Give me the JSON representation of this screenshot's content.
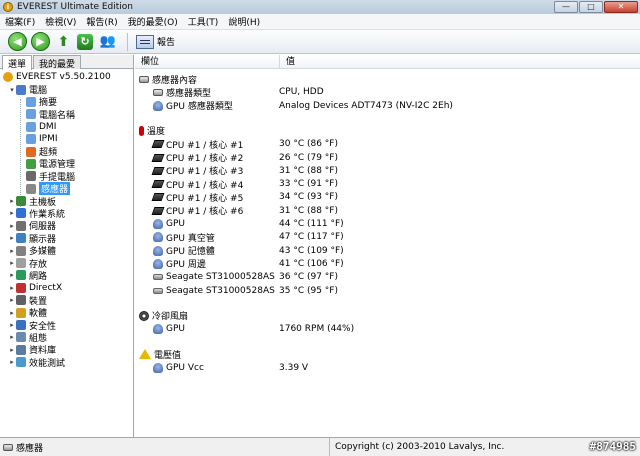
{
  "window": {
    "title": "EVEREST Ultimate Edition",
    "minimize": "—",
    "maximize": "□",
    "close": "✕"
  },
  "menu": [
    "檔案(F)",
    "檢視(V)",
    "報告(R)",
    "我的最愛(O)",
    "工具(T)",
    "說明(H)"
  ],
  "toolbar": {
    "report_label": "報告"
  },
  "left_tabs": [
    "選單",
    "我的最愛"
  ],
  "tree": [
    {
      "label": "EVEREST v5.50.2100",
      "level": 0,
      "icon": "info-icon",
      "color": "#e8a010"
    },
    {
      "label": "電腦",
      "level": 1,
      "icon": "computer-icon",
      "color": "#4a7ac8",
      "expander": "▾"
    },
    {
      "label": "摘要",
      "level": 2,
      "icon": "summary-icon",
      "color": "#6aa0e0"
    },
    {
      "label": "電腦名稱",
      "level": 2,
      "icon": "computer-name-icon",
      "color": "#6aa0e0"
    },
    {
      "label": "DMI",
      "level": 2,
      "icon": "dmi-icon",
      "color": "#6aa0e0"
    },
    {
      "label": "IPMI",
      "level": 2,
      "icon": "ipmi-icon",
      "color": "#6aa0e0"
    },
    {
      "label": "超頻",
      "level": 2,
      "icon": "overclock-icon",
      "color": "#e06a20"
    },
    {
      "label": "電源管理",
      "level": 2,
      "icon": "power-icon",
      "color": "#40a040"
    },
    {
      "label": "手提電腦",
      "level": 2,
      "icon": "laptop-icon",
      "color": "#6a6a6a"
    },
    {
      "label": "感應器",
      "level": 2,
      "icon": "sensor-icon",
      "color": "#888888",
      "selected": true
    },
    {
      "label": "主機板",
      "level": 1,
      "icon": "motherboard-icon",
      "color": "#3a8a3a",
      "expander": "▸"
    },
    {
      "label": "作業系統",
      "level": 1,
      "icon": "os-icon",
      "color": "#3070d0",
      "expander": "▸"
    },
    {
      "label": "伺服器",
      "level": 1,
      "icon": "server-icon",
      "color": "#707070",
      "expander": "▸"
    },
    {
      "label": "顯示器",
      "level": 1,
      "icon": "display-icon",
      "color": "#4080c0",
      "expander": "▸"
    },
    {
      "label": "多媒體",
      "level": 1,
      "icon": "multimedia-icon",
      "color": "#808080",
      "expander": "▸"
    },
    {
      "label": "存放",
      "level": 1,
      "icon": "storage-icon",
      "color": "#a0a0a0",
      "expander": "▸"
    },
    {
      "label": "網路",
      "level": 1,
      "icon": "network-icon",
      "color": "#2a9a5a",
      "expander": "▸"
    },
    {
      "label": "DirectX",
      "level": 1,
      "icon": "directx-icon",
      "color": "#c03030",
      "expander": "▸"
    },
    {
      "label": "裝置",
      "level": 1,
      "icon": "devices-icon",
      "color": "#606060",
      "expander": "▸"
    },
    {
      "label": "軟體",
      "level": 1,
      "icon": "software-icon",
      "color": "#d0a020",
      "expander": "▸"
    },
    {
      "label": "安全性",
      "level": 1,
      "icon": "security-icon",
      "color": "#3a70c0",
      "expander": "▸"
    },
    {
      "label": "組態",
      "level": 1,
      "icon": "config-icon",
      "color": "#6a8ab0",
      "expander": "▸"
    },
    {
      "label": "資料庫",
      "level": 1,
      "icon": "database-icon",
      "color": "#5a7aa0",
      "expander": "▸"
    },
    {
      "label": "效能測試",
      "level": 1,
      "icon": "benchmark-icon",
      "color": "#4a9ad0",
      "expander": "▸"
    }
  ],
  "columns": {
    "field": "欄位",
    "value": "值"
  },
  "sections": [
    {
      "title": "感應器內容",
      "icon": "sensor-icon",
      "rows": [
        {
          "name": "感應器類型",
          "value": "CPU, HDD",
          "icon": "sensor-icon"
        },
        {
          "name": "GPU 感應器類型",
          "value": "Analog Devices ADT7473  (NV-I2C 2Eh)",
          "icon": "gpu-icon"
        }
      ]
    },
    {
      "title": "溫度",
      "icon": "thermometer-icon",
      "rows": [
        {
          "name": "CPU #1 / 核心 #1",
          "value": "30 °C  (86 °F)",
          "icon": "cpu-icon"
        },
        {
          "name": "CPU #1 / 核心 #2",
          "value": "26 °C  (79 °F)",
          "icon": "cpu-icon"
        },
        {
          "name": "CPU #1 / 核心 #3",
          "value": "31 °C  (88 °F)",
          "icon": "cpu-icon"
        },
        {
          "name": "CPU #1 / 核心 #4",
          "value": "33 °C  (91 °F)",
          "icon": "cpu-icon"
        },
        {
          "name": "CPU #1 / 核心 #5",
          "value": "34 °C  (93 °F)",
          "icon": "cpu-icon"
        },
        {
          "name": "CPU #1 / 核心 #6",
          "value": "31 °C  (88 °F)",
          "icon": "cpu-icon"
        },
        {
          "name": "GPU",
          "value": "44 °C  (111 °F)",
          "icon": "gpu-icon"
        },
        {
          "name": "GPU 真空管",
          "value": "47 °C  (117 °F)",
          "icon": "gpu-icon"
        },
        {
          "name": "GPU 記憶體",
          "value": "43 °C  (109 °F)",
          "icon": "gpu-icon"
        },
        {
          "name": "GPU 周邊",
          "value": "41 °C  (106 °F)",
          "icon": "gpu-icon"
        },
        {
          "name": "Seagate ST31000528AS",
          "value": "36 °C  (97 °F)",
          "icon": "hdd-icon"
        },
        {
          "name": "Seagate ST31000528AS",
          "value": "35 °C  (95 °F)",
          "icon": "hdd-icon"
        }
      ]
    },
    {
      "title": "冷卻風扇",
      "icon": "fan-icon",
      "rows": [
        {
          "name": "GPU",
          "value": "1760 RPM  (44%)",
          "icon": "gpu-icon"
        }
      ]
    },
    {
      "title": "電壓值",
      "icon": "warning-icon",
      "rows": [
        {
          "name": "GPU Vcc",
          "value": "3.39 V",
          "icon": "gpu-icon"
        }
      ]
    }
  ],
  "status": {
    "left": "感應器",
    "right": "Copyright (c) 2003-2010 Lavalys, Inc."
  },
  "watermark": "#874985"
}
